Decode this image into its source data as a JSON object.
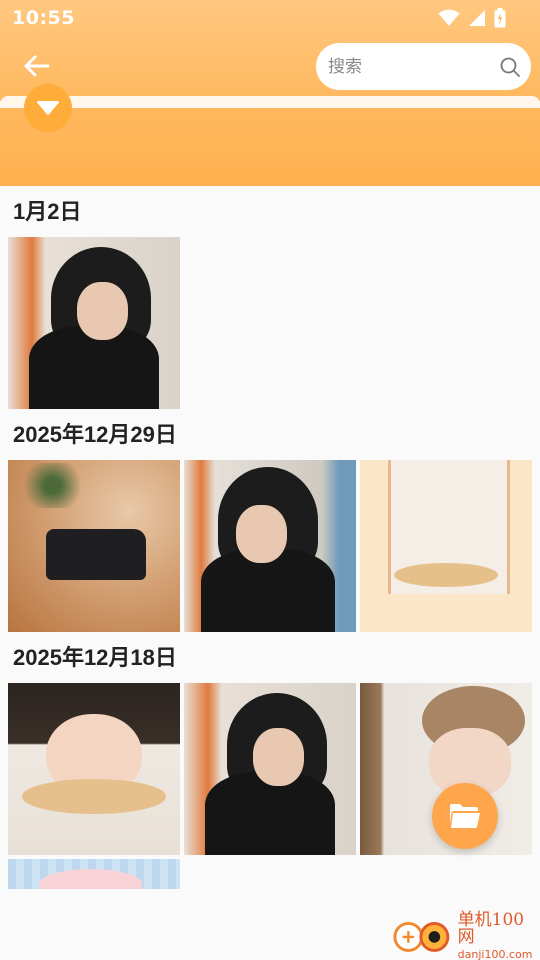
{
  "status_bar": {
    "time": "10:55",
    "icons": [
      "wifi-icon",
      "cellular-signal-icon",
      "battery-charging-icon"
    ]
  },
  "header": {
    "back_icon": "arrow-left-icon",
    "search": {
      "placeholder": "搜索",
      "value": "",
      "icon": "search-icon"
    },
    "dropdown_icon": "triangle-down-icon"
  },
  "colors": {
    "header_top": "#ffc880",
    "header_bottom": "#ffb14f",
    "accent": "#ffad3a",
    "fab": "#ffa64d",
    "background": "#fafafa"
  },
  "groups": [
    {
      "date": "1月2日",
      "photo_count": 1
    },
    {
      "date": "2025年12月29日",
      "photo_count": 3
    },
    {
      "date": "2025年12月18日",
      "photo_count": 4
    }
  ],
  "fab_icon": "folder-icon",
  "watermark": {
    "name": "单机100网",
    "url": "danji100.com"
  }
}
